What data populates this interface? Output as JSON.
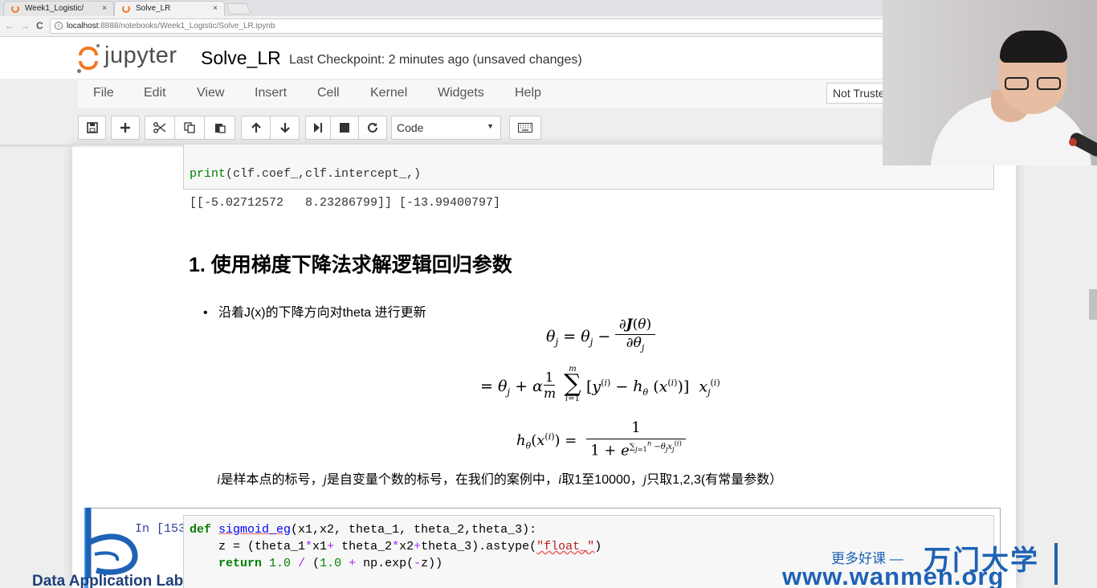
{
  "browser": {
    "tabs": [
      {
        "title": "Week1_Logistic/",
        "close": "×"
      },
      {
        "title": "Solve_LR",
        "close": "×"
      }
    ],
    "nav": {
      "back": "←",
      "forward": "→",
      "reload": "C"
    },
    "address": {
      "host": "localhost",
      "path": ":8888/notebooks/Week1_Logistic/Solve_LR.ipynb",
      "info": "i"
    }
  },
  "jupyter": {
    "wordmark": "jupyter",
    "notebook_title": "Solve_LR",
    "checkpoint": "Last Checkpoint: 2 minutes ago (unsaved changes)",
    "menu": [
      "File",
      "Edit",
      "View",
      "Insert",
      "Cell",
      "Kernel",
      "Widgets",
      "Help"
    ],
    "trust": "Not Trusted",
    "toolbar_icons": [
      "save-icon",
      "plus-icon",
      "cut-icon",
      "copy-icon",
      "paste-icon",
      "arrow-up-icon",
      "arrow-down-icon",
      "step-icon",
      "stop-icon",
      "restart-icon",
      "keyboard-icon"
    ],
    "cell_type": "Code"
  },
  "notebook": {
    "cell1": {
      "code_fn": "print",
      "code_rest": "(clf.coef_,clf.intercept_,)",
      "output": "[[-5.02712572   8.23286799]] [-13.99400797]"
    },
    "heading": "1. 使用梯度下降法求解逻辑回归参数",
    "bullet": "沿着J(x)的下降方向对theta 进行更新",
    "note_parts": [
      "i",
      "是样本点的标号，",
      "j",
      "是自变量个数的标号，在我们的案例中，",
      "i",
      "取1至10000，",
      "j",
      "只取1,2,3(有常量参数）"
    ],
    "cell2": {
      "prompt": "In [153]:",
      "line1": {
        "kw": "def",
        "fn": "sigmoid_eg",
        "args": "(x1,x2, theta_1, theta_2,theta_3):"
      },
      "line2": {
        "a": "    z = (theta_1",
        "op1": "*",
        "b": "x1",
        "op2": "+",
        "c": " theta_2",
        "op3": "*",
        "d": "x2",
        "op4": "+",
        "e": "theta_3).astype(",
        "str": "\"float_\"",
        "f": ")"
      },
      "line3": {
        "kw": "return",
        "n1": "1.0",
        "op1": " / ",
        "a": "(",
        "n2": "1.0",
        "op2": " + ",
        "b": "np.exp(",
        "op3": "-",
        "c": "z))"
      }
    }
  },
  "watermarks": {
    "left": "Data Application Lab",
    "right_small": "更多好课 —",
    "right_brand": "万门大学",
    "right_url": "www.wanmen.org"
  },
  "colors": {
    "jupyter_orange": "#f37726",
    "link_blue": "#1f62b5",
    "cell_selected": "#42a5f5"
  }
}
